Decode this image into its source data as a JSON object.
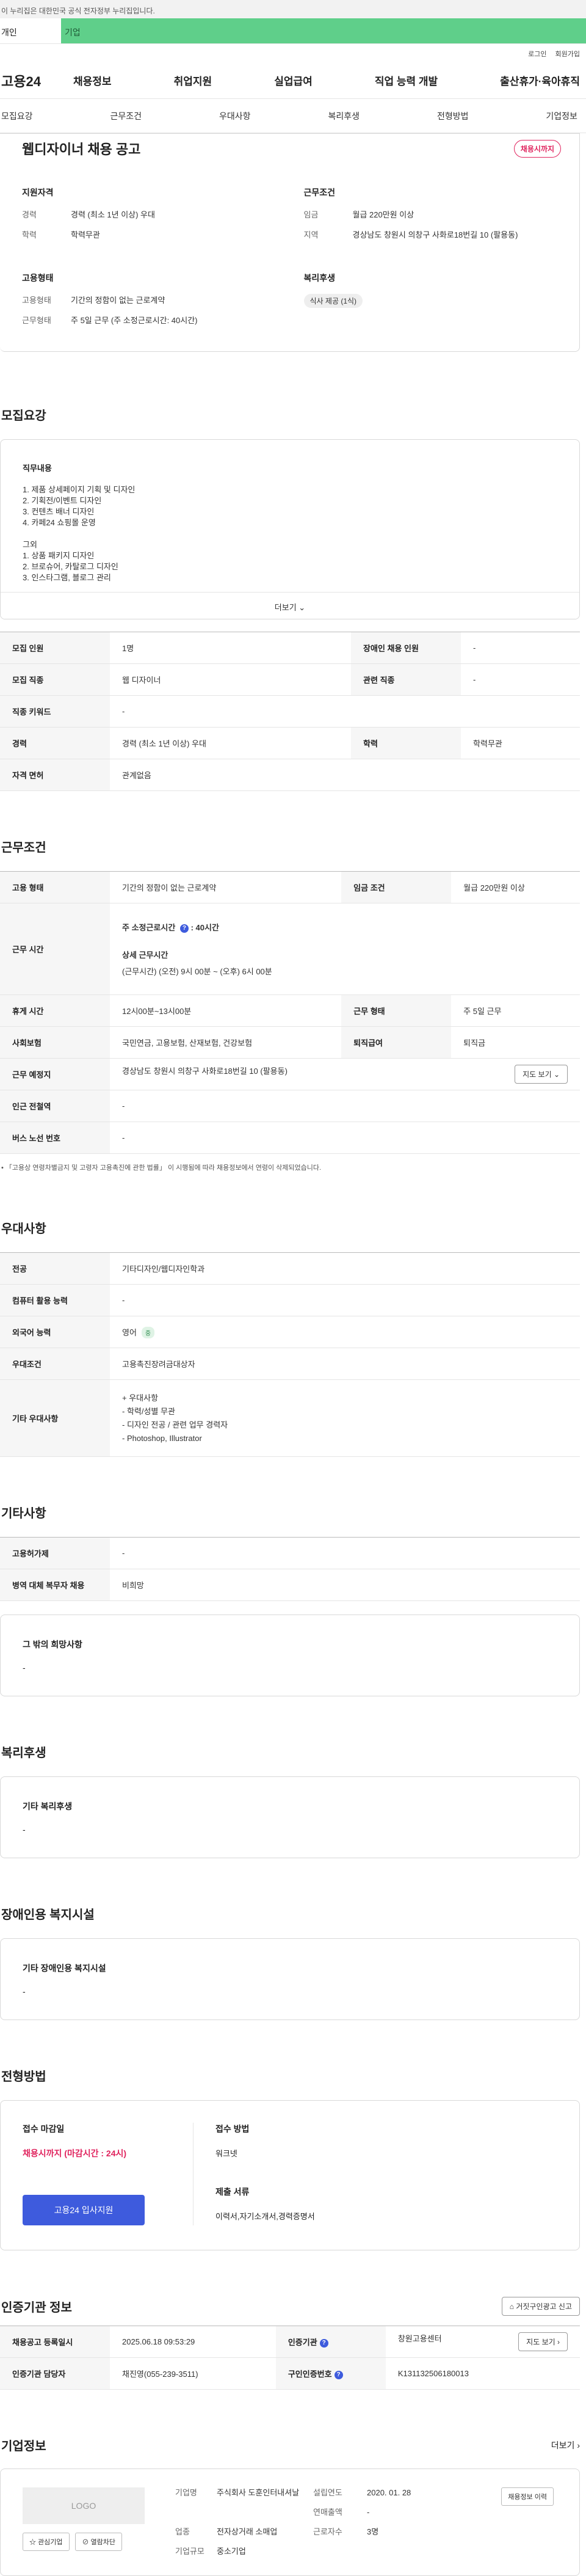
{
  "gov_bar": "이 누리집은 대한민국 공식 전자정부 누리집입니다.",
  "persona": {
    "individual": "개인",
    "company": "기업"
  },
  "util": [
    "로그인",
    "회원가입"
  ],
  "logo": "고용24",
  "gnb": [
    "채용정보",
    "취업지원",
    "실업급여",
    "직업 능력 개발",
    "출산휴가·육아휴직"
  ],
  "tabs": [
    "모집요강",
    "근무조건",
    "우대사항",
    "복리후생",
    "전형방법",
    "기업정보"
  ],
  "summary": {
    "title": "웹디자이너 채용 공고",
    "status": "채용시까지",
    "qual": {
      "heading": "지원자격",
      "rows": [
        {
          "k": "경력",
          "v": "경력 (최소 1년 이상) 우대"
        },
        {
          "k": "학력",
          "v": "학력무관"
        }
      ]
    },
    "cond": {
      "heading": "근무조건",
      "rows": [
        {
          "k": "임금",
          "v": "월급 220만원 이상"
        },
        {
          "k": "지역",
          "v": "경상남도 창원시 의창구 사화로18번길 10 (팔용동)"
        }
      ]
    },
    "emp": {
      "heading": "고용형태",
      "rows": [
        {
          "k": "고용형태",
          "v": "기간의 정함이 없는 근로계약"
        },
        {
          "k": "근무형태",
          "v": "주 5일 근무 (주 소정근로시간: 40시간)"
        }
      ]
    },
    "welfare": {
      "heading": "복리후생",
      "badge": "식사 제공 (1식)"
    }
  },
  "recruit": {
    "title": "모집요강",
    "duty_label": "직무내용",
    "duty_text": "1. 제품 상세페이지 기획 및 디자인\n2. 기획전/이벤트 디자인\n3. 컨텐츠 배너 디자인\n4. 카페24 쇼핑몰 운영\n\n그외\n1. 상품 패키지 디자인\n2. 브로슈어, 카탈로그 디자인\n3. 인스타그램, 블로그 관리",
    "more": "더보기",
    "rows": [
      [
        "모집 인원",
        "1명",
        "장애인 채용 인원",
        "-"
      ],
      [
        "모집 직종",
        "웹 디자이너",
        "관련 직종",
        "-"
      ],
      [
        "직종 키워드",
        "-"
      ],
      [
        "경력",
        "경력 (최소 1년 이상) 우대",
        "학력",
        "학력무관"
      ],
      [
        "자격 면허",
        "관계없음"
      ]
    ]
  },
  "work": {
    "title": "근무조건",
    "type_k": "고용 형태",
    "type_v": "기간의 정함이 없는 근로계약",
    "wage_k": "임금 조건",
    "wage_v": "월급 220만원 이상",
    "time_k": "근무 시간",
    "time_total_label": "주 소정근로시간",
    "time_total": ": 40시간",
    "time_detail_label": "상세 근무시간",
    "time_detail": "(근무시간) (오전) 9시 00분 ~ (오후) 6시 00분",
    "rest_k": "휴게 시간",
    "rest_v": "12시00분~13시00분",
    "form_k": "근무 형태",
    "form_v": "주 5일 근무",
    "ins_k": "사회보험",
    "ins_v": "국민연금, 고용보험, 산재보험, 건강보험",
    "ret_k": "퇴직급여",
    "ret_v": "퇴직금",
    "place_k": "근무 예정지",
    "place_v": "경상남도 창원시 의창구 사화로18번길 10 (팔용동)",
    "map_btn": "지도 보기",
    "subway_k": "인근 전철역",
    "subway_v": "-",
    "bus_k": "버스 노선 번호",
    "bus_v": "-",
    "note": "「고용상 연령차별금지 및 고령자 고용촉진에 관한 법률」 이 시행됨에 따라 채용정보에서 연령이 삭제되었습니다."
  },
  "pref": {
    "title": "우대사항",
    "rows": [
      [
        "전공",
        "기타디자인/웹디자인학과"
      ],
      [
        "컴퓨터 활용 능력",
        "-"
      ],
      [
        "외국어 능력",
        "영어"
      ],
      [
        "우대조건",
        "고용촉진장려금대상자"
      ]
    ],
    "lang_tag": "중",
    "other_k": "기타 우대사항",
    "other_v": "+ 우대사항\n- 학력/성별 무관\n- 디자인 전공 / 관련 업무 경력자\n- Photoshop, Illustrator"
  },
  "etc": {
    "title": "기타사항",
    "rows": [
      [
        "고용허가제",
        "-"
      ],
      [
        "병역 대체 복무자 채용",
        "비희망"
      ]
    ],
    "hope_label": "그 밖의 희망사항",
    "hope_v": "-"
  },
  "benefit": {
    "title": "복리후생",
    "label": "기타 복리후생",
    "value": "-"
  },
  "disabled": {
    "title": "장애인용 복지시설",
    "label": "기타 장애인용 복지시설",
    "value": "-"
  },
  "method": {
    "title": "전형방법",
    "deadline_label": "접수 마감일",
    "deadline_v": "채용시까지 (마감시간 : 24시)",
    "apply_btn": "고용24 입사지원",
    "how_label": "접수 방법",
    "how_v": "워크넷",
    "docs_label": "제출 서류",
    "docs_v": "이력서,자기소개서,경력증명서"
  },
  "cert": {
    "title": "인증기관 정보",
    "report_btn": "거짓구인광고 신고",
    "reg_k": "채용공고 등록일시",
    "reg_v": "2025.06.18 09:53:29",
    "org_k": "인증기관",
    "org_v": "창원고용센터",
    "map_btn": "지도 보기",
    "mgr_k": "인증기관 담당자",
    "mgr_v": "채진영(055-239-3511)",
    "no_k": "구인인증번호",
    "no_v": "K131132506180013"
  },
  "company": {
    "title": "기업정보",
    "more": "더보기",
    "logo": "LOGO",
    "fav_btn": "관심기업",
    "block_btn": "열람차단",
    "history_btn": "채용정보 이력",
    "name_k": "기업명",
    "name_v": "주식회사 도훈인터내셔날",
    "ind_k": "업종",
    "ind_v": "전자상거래 소매업",
    "size_k": "기업규모",
    "size_v": "중소기업",
    "est_k": "설립연도",
    "est_v": "2020. 01. 28",
    "sales_k": "연매출액",
    "sales_v": "-",
    "emp_k": "근로자수",
    "emp_v": "3명"
  }
}
